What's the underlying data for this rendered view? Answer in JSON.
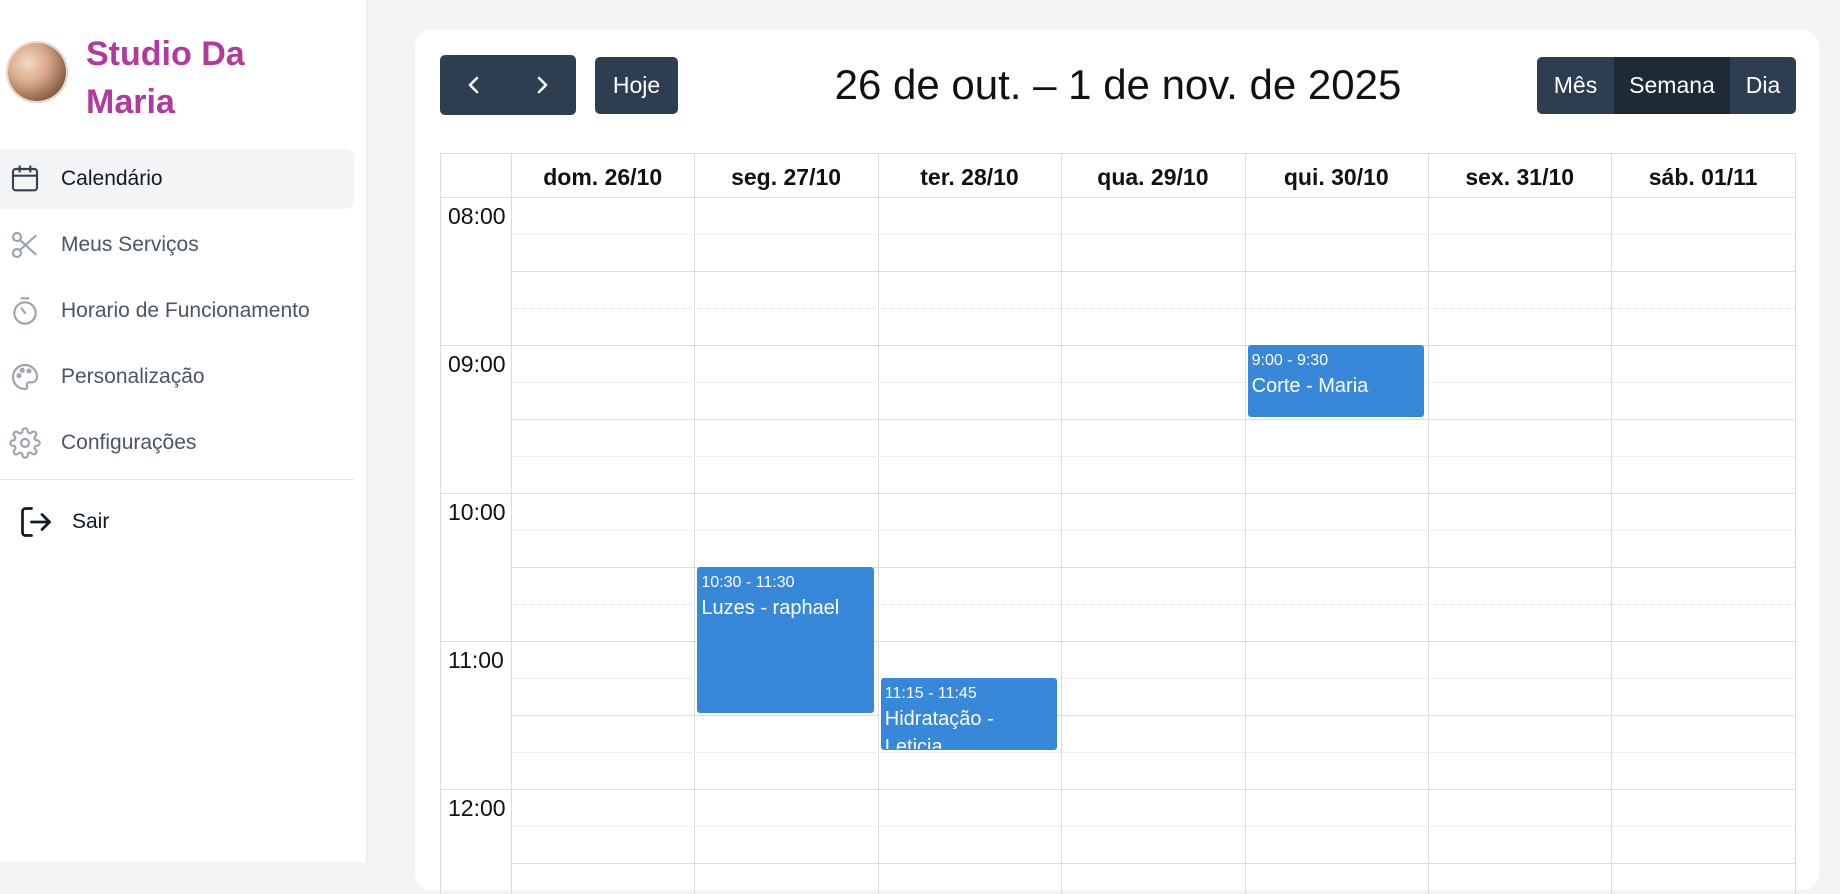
{
  "brand": {
    "name": "Studio Da Maria"
  },
  "nav": {
    "items": [
      {
        "label": "Calendário",
        "icon": "calendar-icon",
        "active": true
      },
      {
        "label": "Meus Serviços",
        "icon": "scissors-icon",
        "active": false
      },
      {
        "label": "Horario de Funcionamento",
        "icon": "stopwatch-icon",
        "active": false
      },
      {
        "label": "Personalização",
        "icon": "palette-icon",
        "active": false
      },
      {
        "label": "Configurações",
        "icon": "gear-icon",
        "active": false
      }
    ],
    "logout_label": "Sair"
  },
  "calendar": {
    "title": "26 de out. – 1 de nov. de 2025",
    "today_label": "Hoje",
    "views": [
      {
        "label": "Mês",
        "active": false
      },
      {
        "label": "Semana",
        "active": true
      },
      {
        "label": "Dia",
        "active": false
      }
    ],
    "days": [
      "dom. 26/10",
      "seg. 27/10",
      "ter. 28/10",
      "qua. 29/10",
      "qui. 30/10",
      "sex. 31/10",
      "sáb. 01/11"
    ],
    "hours": [
      "08:00",
      "09:00",
      "10:00",
      "11:00",
      "12:00"
    ],
    "events": [
      {
        "day": 4,
        "start": 9.0,
        "end": 9.5,
        "time": "9:00 - 9:30",
        "title": "Corte - Maria"
      },
      {
        "day": 1,
        "start": 10.5,
        "end": 11.5,
        "time": "10:30 - 11:30",
        "title": "Luzes - raphael"
      },
      {
        "day": 2,
        "start": 11.25,
        "end": 11.75,
        "time": "11:15 - 11:45",
        "title": "Hidratação - Leticia"
      }
    ]
  },
  "colors": {
    "brand": "#b23a9b",
    "button_bg": "#2c3e50",
    "button_active_bg": "#1e2b37",
    "event_bg": "#3788d8"
  }
}
